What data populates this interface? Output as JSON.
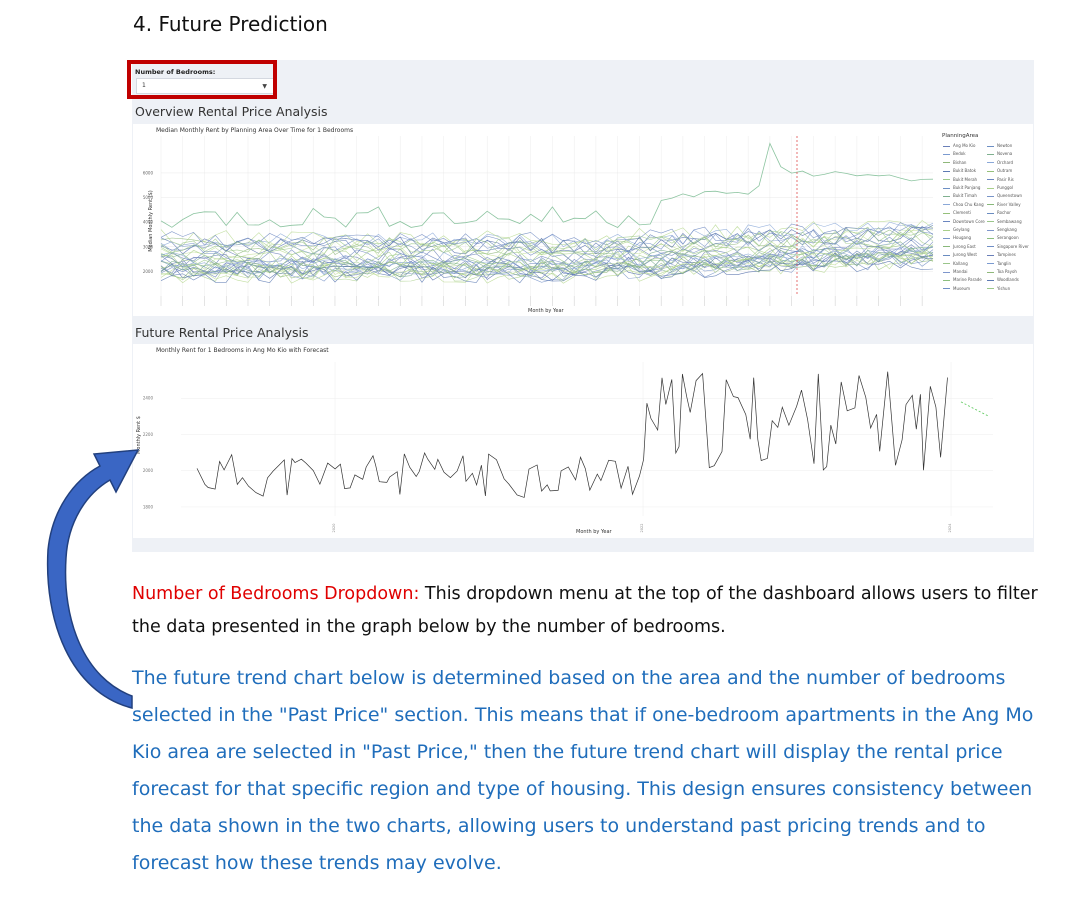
{
  "doc": {
    "heading": "4.  Future Prediction"
  },
  "dashboard": {
    "dropdown": {
      "label": "Number of Bedrooms:",
      "value": "1"
    },
    "overview": {
      "section_title": "Overview Rental Price Analysis",
      "chart_title": "Median Monthly Rent by Planning Area Over Time for 1 Bedrooms",
      "ylabel": "Median Monthly Rent ($)",
      "xlabel": "Month by Year",
      "legend_title": "PlanningArea",
      "legend_left": [
        "Ang Mo Kio",
        "Bedok",
        "Bishan",
        "Bukit Batok",
        "Bukit Merah",
        "Bukit Panjang",
        "Bukit Timah",
        "Choa Chu Kang",
        "Clementi",
        "Downtown Core",
        "Geylang",
        "Hougang",
        "Jurong East",
        "Jurong West",
        "Kallang",
        "Mandai",
        "Marine Parade",
        "Museum"
      ],
      "legend_right": [
        "Newton",
        "Novena",
        "Orchard",
        "Outram",
        "Pasir Ris",
        "Punggol",
        "Queenstown",
        "River Valley",
        "Rochor",
        "Sembawang",
        "Sengkang",
        "Serangoon",
        "Singapore River",
        "Tampines",
        "Tanglin",
        "Toa Payoh",
        "Woodlands",
        "Yishun"
      ],
      "yticks": [
        "2000",
        "3000",
        "4000",
        "5000",
        "6000"
      ]
    },
    "future": {
      "section_title": "Future Rental Price Analysis",
      "chart_title": "Monthly Rent for 1 Bedrooms in Ang Mo Kio with Forecast",
      "ylabel": "Monthly Rent $",
      "xlabel": "Month by Year",
      "yticks": [
        "1800",
        "2000",
        "2200",
        "2400"
      ],
      "xticks": [
        "2020",
        "2022",
        "2024"
      ]
    }
  },
  "paragraphs": {
    "p1_red": "Number of Bedrooms Dropdown:",
    "p1_rest": " This dropdown menu at the top of the dashboard allows users to filter the data presented in the graph below by the number of bedrooms.",
    "p2": "The future trend chart below is determined based on the area and the number of bedrooms selected in the \"Past Price\" section. This means that if one-bedroom apartments in the Ang Mo Kio area are selected in \"Past Price,\" then the future trend chart will display the rental price forecast for that specific region and type of housing. This design ensures consistency between the data shown in the two charts, allowing users to understand past pricing trends and to forecast how these trends may evolve."
  },
  "colors": {
    "red_box": "#c00000",
    "blue_text": "#1f6dbb",
    "arrow_fill": "#3a66c4",
    "arrow_stroke": "#22407e"
  },
  "chart_data": [
    {
      "type": "line",
      "title": "Median Monthly Rent by Planning Area Over Time for 1 Bedrooms",
      "xlabel": "Month by Year",
      "ylabel": "Median Monthly Rent ($)",
      "ylim": [
        1000,
        7500
      ],
      "legend": "right",
      "grid": true,
      "series_count": 36,
      "highlight_series": {
        "name": "Orchard",
        "approx_values_start": 4200,
        "approx_peak": 7200
      }
    },
    {
      "type": "line",
      "title": "Monthly Rent for 1 Bedrooms in Ang Mo Kio with Forecast",
      "xlabel": "Month by Year",
      "ylabel": "Monthly Rent $",
      "ylim": [
        1750,
        2600
      ],
      "x_ticks": [
        "2020",
        "2022",
        "2024"
      ],
      "series": [
        {
          "name": "",
          "approx_range": [
            1850,
            2100
          ],
          "period": "2019-2022"
        },
        {
          "name": "",
          "approx_range": [
            2000,
            2550
          ],
          "period": "2022-2024"
        }
      ],
      "forecast": {
        "style": "dashed green",
        "approx_values": [
          2380,
          2300
        ]
      }
    }
  ]
}
